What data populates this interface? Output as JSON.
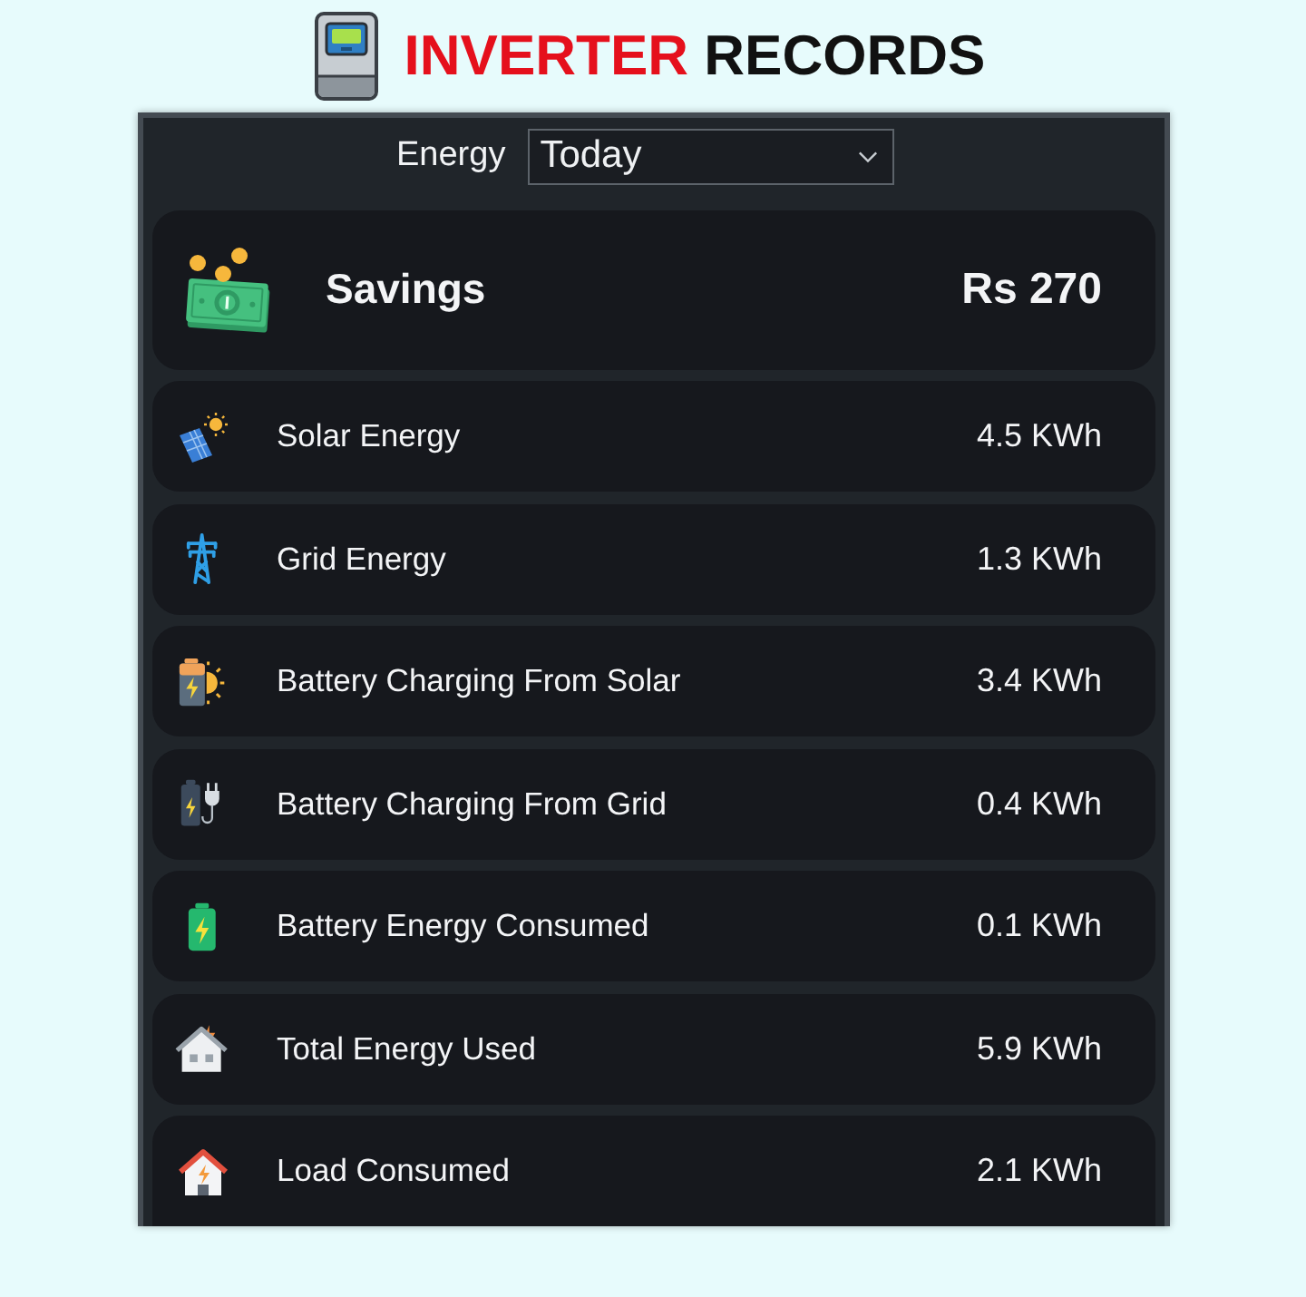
{
  "header": {
    "title_accent": "INVERTER",
    "title_rest": "RECORDS"
  },
  "filter": {
    "label": "Energy",
    "value": "Today"
  },
  "savings": {
    "label": "Savings",
    "value": "Rs 270"
  },
  "rows": [
    {
      "kind": "solar",
      "label": "Solar Energy",
      "value": "4.5 KWh"
    },
    {
      "kind": "grid",
      "label": "Grid Energy",
      "value": "1.3 KWh"
    },
    {
      "kind": "sunbattery",
      "label": "Battery Charging From Solar",
      "value": "3.4 KWh"
    },
    {
      "kind": "plugbattery",
      "label": "Battery Charging From Grid",
      "value": "0.4 KWh"
    },
    {
      "kind": "battery",
      "label": "Battery Energy Consumed",
      "value": "0.1 KWh"
    },
    {
      "kind": "house",
      "label": "Total Energy Used",
      "value": "5.9 KWh"
    },
    {
      "kind": "home",
      "label": "Load Consumed",
      "value": "2.1 KWh"
    }
  ]
}
